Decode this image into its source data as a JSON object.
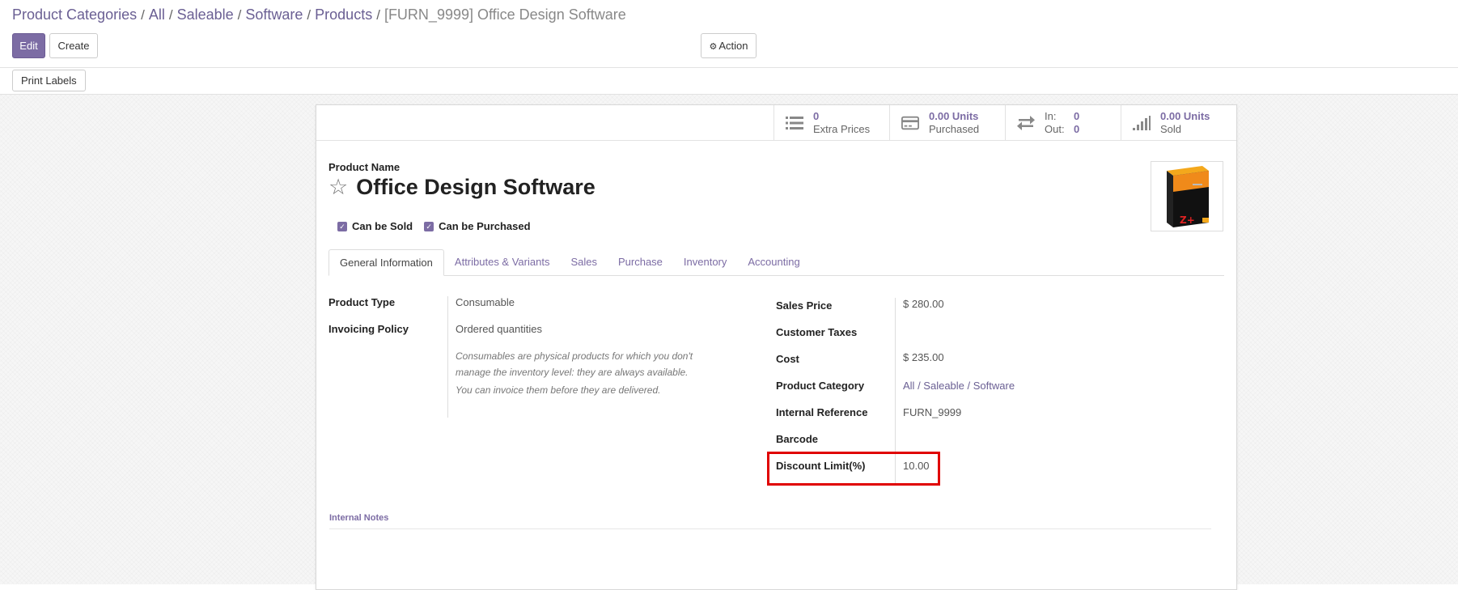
{
  "breadcrumb": {
    "items": [
      "Product Categories",
      "All",
      "Saleable",
      "Software",
      "Products"
    ],
    "current": "[FURN_9999] Office Design Software"
  },
  "toolbar": {
    "edit_label": "Edit",
    "create_label": "Create",
    "action_label": "Action",
    "print_labels": "Print Labels"
  },
  "stats": {
    "extra_prices": {
      "value": "0",
      "label": "Extra Prices"
    },
    "purchased": {
      "value": "0.00 Units",
      "label": "Purchased"
    },
    "inout": {
      "in_label": "In:",
      "in_value": "0",
      "out_label": "Out:",
      "out_value": "0"
    },
    "sold": {
      "value": "0.00 Units",
      "label": "Sold"
    }
  },
  "product": {
    "name_label": "Product Name",
    "name": "Office Design Software",
    "can_be_sold": "Can be Sold",
    "can_be_purchased": "Can be Purchased"
  },
  "tabs": [
    "General Information",
    "Attributes & Variants",
    "Sales",
    "Purchase",
    "Inventory",
    "Accounting"
  ],
  "general": {
    "product_type_label": "Product Type",
    "product_type": "Consumable",
    "invoicing_policy_label": "Invoicing Policy",
    "invoicing_policy": "Ordered quantities",
    "help1": "Consumables are physical products for which you don't manage the inventory level: they are always available.",
    "help2": "You can invoice them before they are delivered.",
    "sales_price_label": "Sales Price",
    "sales_price": "$ 280.00",
    "customer_taxes_label": "Customer Taxes",
    "cost_label": "Cost",
    "cost": "$ 235.00",
    "category_label": "Product Category",
    "category": [
      "All",
      "Saleable",
      "Software"
    ],
    "internal_ref_label": "Internal Reference",
    "internal_ref": "FURN_9999",
    "barcode_label": "Barcode",
    "discount_label": "Discount Limit(%)",
    "discount": "10.00"
  },
  "notes": {
    "label": "Internal Notes"
  },
  "colors": {
    "accent": "#7c6ca4",
    "highlight": "#e00000"
  }
}
